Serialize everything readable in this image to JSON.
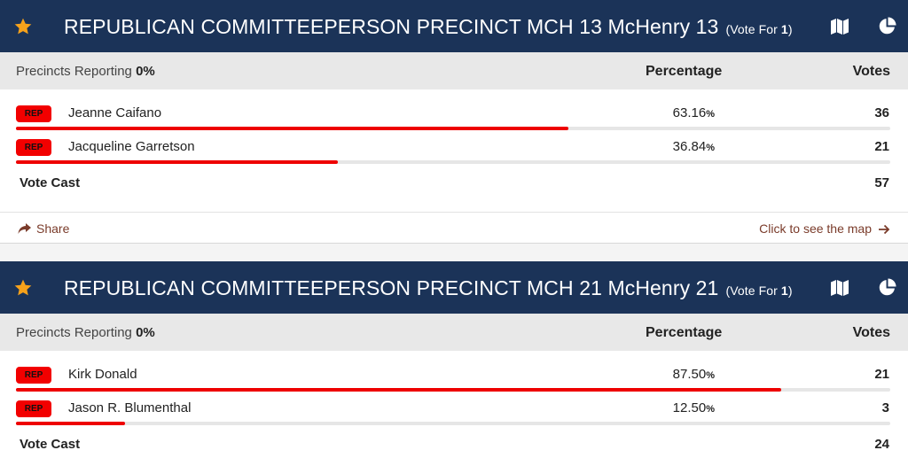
{
  "contests": [
    {
      "title": "REPUBLICAN COMMITTEEPERSON PRECINCT MCH 13 McHenry 13",
      "vote_for_prefix": "(Vote For ",
      "vote_for_count": "1",
      "vote_for_suffix": ")",
      "reporting_label": "Precincts Reporting",
      "reporting_value": "0%",
      "percentage_header": "Percentage",
      "votes_header": "Votes",
      "candidates": [
        {
          "party": "REP",
          "name": "Jeanne Caifano",
          "pct": "63.16",
          "votes": "36",
          "share": 0.6316
        },
        {
          "party": "REP",
          "name": "Jacqueline Garretson",
          "pct": "36.84",
          "votes": "21",
          "share": 0.3684
        }
      ],
      "cast_label": "Vote Cast",
      "cast_total": "57",
      "share_label": "Share",
      "map_label": "Click to see the map"
    },
    {
      "title": "REPUBLICAN COMMITTEEPERSON PRECINCT MCH 21 McHenry 21",
      "vote_for_prefix": "(Vote For ",
      "vote_for_count": "1",
      "vote_for_suffix": ")",
      "reporting_label": "Precincts Reporting",
      "reporting_value": "0%",
      "percentage_header": "Percentage",
      "votes_header": "Votes",
      "candidates": [
        {
          "party": "REP",
          "name": "Kirk Donald",
          "pct": "87.50",
          "votes": "21",
          "share": 0.875
        },
        {
          "party": "REP",
          "name": "Jason R. Blumenthal",
          "pct": "12.50",
          "votes": "3",
          "share": 0.125
        }
      ],
      "cast_label": "Vote Cast",
      "cast_total": "24"
    }
  ],
  "pct_sign": "%",
  "icons": {
    "favorite": "star-icon",
    "map": "map-icon",
    "chart": "pie-chart-icon",
    "share": "share-arrow-icon",
    "go": "arrow-right-icon"
  },
  "colors": {
    "header_bg": "#1b3358",
    "star": "#f7a21b",
    "party_badge": "#f20000",
    "bar_fill": "#ee0000",
    "link": "#7a3b2a"
  }
}
